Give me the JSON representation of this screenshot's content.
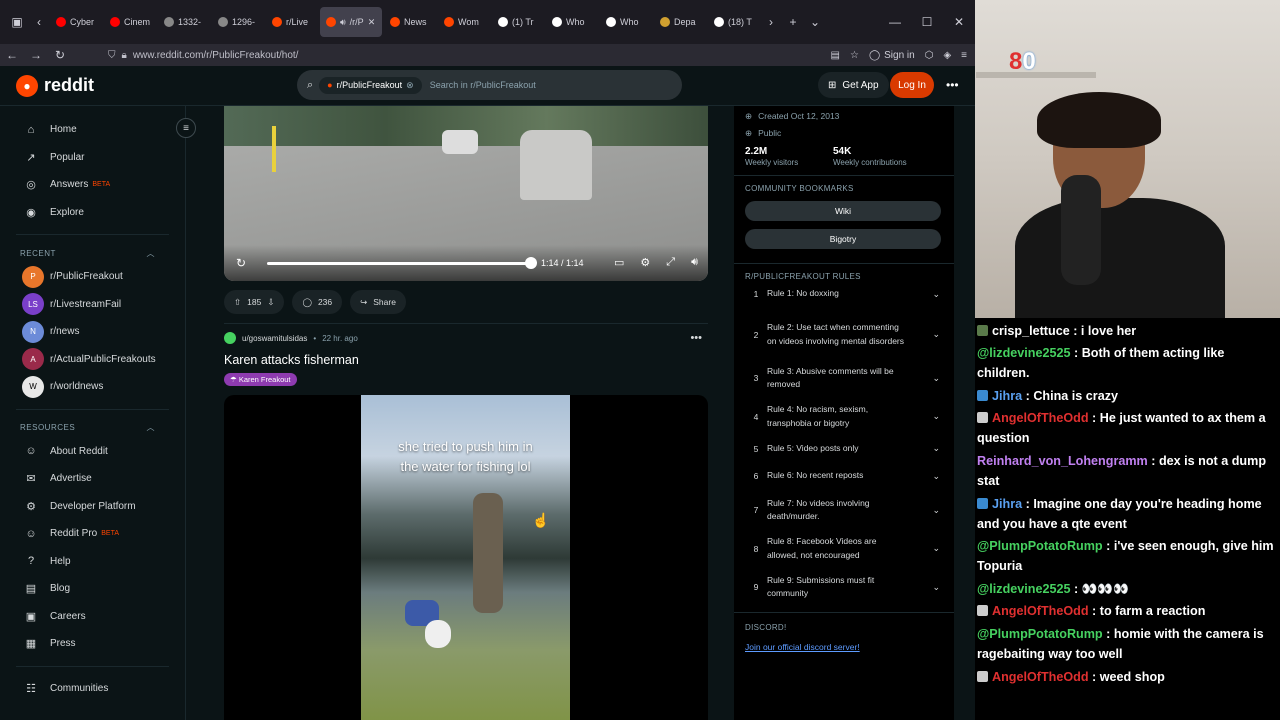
{
  "browser": {
    "tabs": [
      {
        "label": "Cyber",
        "color": "#ff0000"
      },
      {
        "label": "Cinem",
        "color": "#ff0000"
      },
      {
        "label": "1332-",
        "color": "#888888"
      },
      {
        "label": "1296-",
        "color": "#888888"
      },
      {
        "label": "r/Live",
        "color": "#ff4500"
      },
      {
        "label": "/r/P",
        "color": "#ff4500",
        "active": true
      },
      {
        "label": "News",
        "color": "#ff4500"
      },
      {
        "label": "Wom",
        "color": "#ff4500"
      },
      {
        "label": "(1) Tr",
        "color": "#ffffff"
      },
      {
        "label": "Who",
        "color": "#ffffff"
      },
      {
        "label": "Who",
        "color": "#ffffff"
      },
      {
        "label": "Depa",
        "color": "#d0a030"
      },
      {
        "label": "(18) T",
        "color": "#ffffff"
      }
    ],
    "url": "www.reddit.com/r/PublicFreakout/hot/",
    "sign_in": "Sign in"
  },
  "header": {
    "brand": "reddit",
    "search_chip": "r/PublicFreakout",
    "search_placeholder": "Search in r/PublicFreakout",
    "get_app": "Get App",
    "login": "Log In"
  },
  "sidebar": {
    "main": [
      {
        "label": "Home",
        "icon": "home-icon",
        "glyph": "⌂"
      },
      {
        "label": "Popular",
        "icon": "popular-icon",
        "glyph": "↗"
      },
      {
        "label": "Answers",
        "icon": "answers-icon",
        "glyph": "◎",
        "badge": "BETA"
      },
      {
        "label": "Explore",
        "icon": "explore-icon",
        "glyph": "◉"
      }
    ],
    "recent_title": "RECENT",
    "recent": [
      {
        "label": "r/PublicFreakout",
        "color": "#e8762b",
        "initial": "P"
      },
      {
        "label": "r/LivestreamFail",
        "color": "#7a3fc9",
        "initial": "LS"
      },
      {
        "label": "r/news",
        "color": "#6c8bd8",
        "initial": "N"
      },
      {
        "label": "r/ActualPublicFreakouts",
        "color": "#9a2a4a",
        "initial": "A"
      },
      {
        "label": "r/worldnews",
        "color": "#e8e8e8",
        "initial": "W"
      }
    ],
    "resources_title": "RESOURCES",
    "resources": [
      {
        "label": "About Reddit",
        "icon": "reddit-icon",
        "glyph": "☺"
      },
      {
        "label": "Advertise",
        "icon": "advertise-icon",
        "glyph": "✉"
      },
      {
        "label": "Developer Platform",
        "icon": "developer-icon",
        "glyph": "⚙"
      },
      {
        "label": "Reddit Pro",
        "icon": "pro-icon",
        "glyph": "☺",
        "badge": "BETA"
      },
      {
        "label": "Help",
        "icon": "help-icon",
        "glyph": "?"
      },
      {
        "label": "Blog",
        "icon": "blog-icon",
        "glyph": "▤"
      },
      {
        "label": "Careers",
        "icon": "careers-icon",
        "glyph": "▣"
      },
      {
        "label": "Press",
        "icon": "press-icon",
        "glyph": "▦"
      }
    ],
    "communities": "Communities"
  },
  "post1": {
    "video_time": "1:14 / 1:14",
    "video_progress": 1.0,
    "upvotes": "185",
    "comments": "236",
    "share": "Share"
  },
  "post2": {
    "author": "u/goswamitulsidas",
    "age": "22 hr. ago",
    "title": "Karen attacks fisherman",
    "flair": "Karen Freakout",
    "caption_line1": "she tried to push him in",
    "caption_line2": "the water for fishing lol"
  },
  "about": {
    "created": "Created Oct 12, 2013",
    "visibility": "Public",
    "visitors_value": "2.2M",
    "visitors_label": "Weekly visitors",
    "contrib_value": "54K",
    "contrib_label": "Weekly contributions",
    "bookmarks_title": "COMMUNITY BOOKMARKS",
    "bookmarks": [
      "Wiki",
      "Bigotry"
    ],
    "rules_title": "R/PUBLICFREAKOUT RULES",
    "rules": [
      {
        "n": "1",
        "text": "Rule 1: No doxxing"
      },
      {
        "n": "2",
        "text": "Rule 2: Use tact when commenting on videos involving mental disorders"
      },
      {
        "n": "3",
        "text": "Rule 3: Abusive comments will be removed"
      },
      {
        "n": "4",
        "text": "Rule 4: No racism, sexism, transphobia or bigotry"
      },
      {
        "n": "5",
        "text": "Rule 5: Video posts only"
      },
      {
        "n": "6",
        "text": "Rule 6: No recent reposts"
      },
      {
        "n": "7",
        "text": "Rule 7: No videos involving death/murder."
      },
      {
        "n": "8",
        "text": "Rule 8: Facebook Videos are allowed, not encouraged"
      },
      {
        "n": "9",
        "text": "Rule 9: Submissions must fit community"
      }
    ],
    "discord_title": "DISCORD!",
    "discord_link": "Join our official discord server!"
  },
  "stream": {
    "counter_a": "8",
    "counter_b": "0"
  },
  "chat": [
    {
      "user": "crisp_lettuce",
      "color": "#ffffff",
      "text": "i love her",
      "badge": "#5a7a4a"
    },
    {
      "user": "@lizdevine2525",
      "color": "#46d160",
      "text": "Both of them acting like children."
    },
    {
      "user": "Jihra",
      "color": "#5aa0f0",
      "text": "China is crazy",
      "badge": "#3a8ad0"
    },
    {
      "user": "AngelOfTheOdd",
      "color": "#e03030",
      "text": "He just wanted to ax them a question",
      "badge": "#cccccc"
    },
    {
      "user": "Reinhard_von_Lohengramm",
      "color": "#c080f0",
      "text": "dex is not a dump stat"
    },
    {
      "user": "Jihra",
      "color": "#5aa0f0",
      "text": "Imagine one day you're heading home and you have a qte event",
      "badge": "#3a8ad0"
    },
    {
      "user": "@PlumpPotatoRump",
      "color": "#46d160",
      "text": "i've seen enough, give him Topuria"
    },
    {
      "user": "@lizdevine2525",
      "color": "#46d160",
      "text": "👀👀👀"
    },
    {
      "user": "AngelOfTheOdd",
      "color": "#e03030",
      "text": "to farm a reaction",
      "badge": "#cccccc"
    },
    {
      "user": "@PlumpPotatoRump",
      "color": "#46d160",
      "text": "homie with the camera is ragebaiting way too well"
    },
    {
      "user": "AngelOfTheOdd",
      "color": "#e03030",
      "text": "weed shop",
      "badge": "#cccccc"
    }
  ]
}
